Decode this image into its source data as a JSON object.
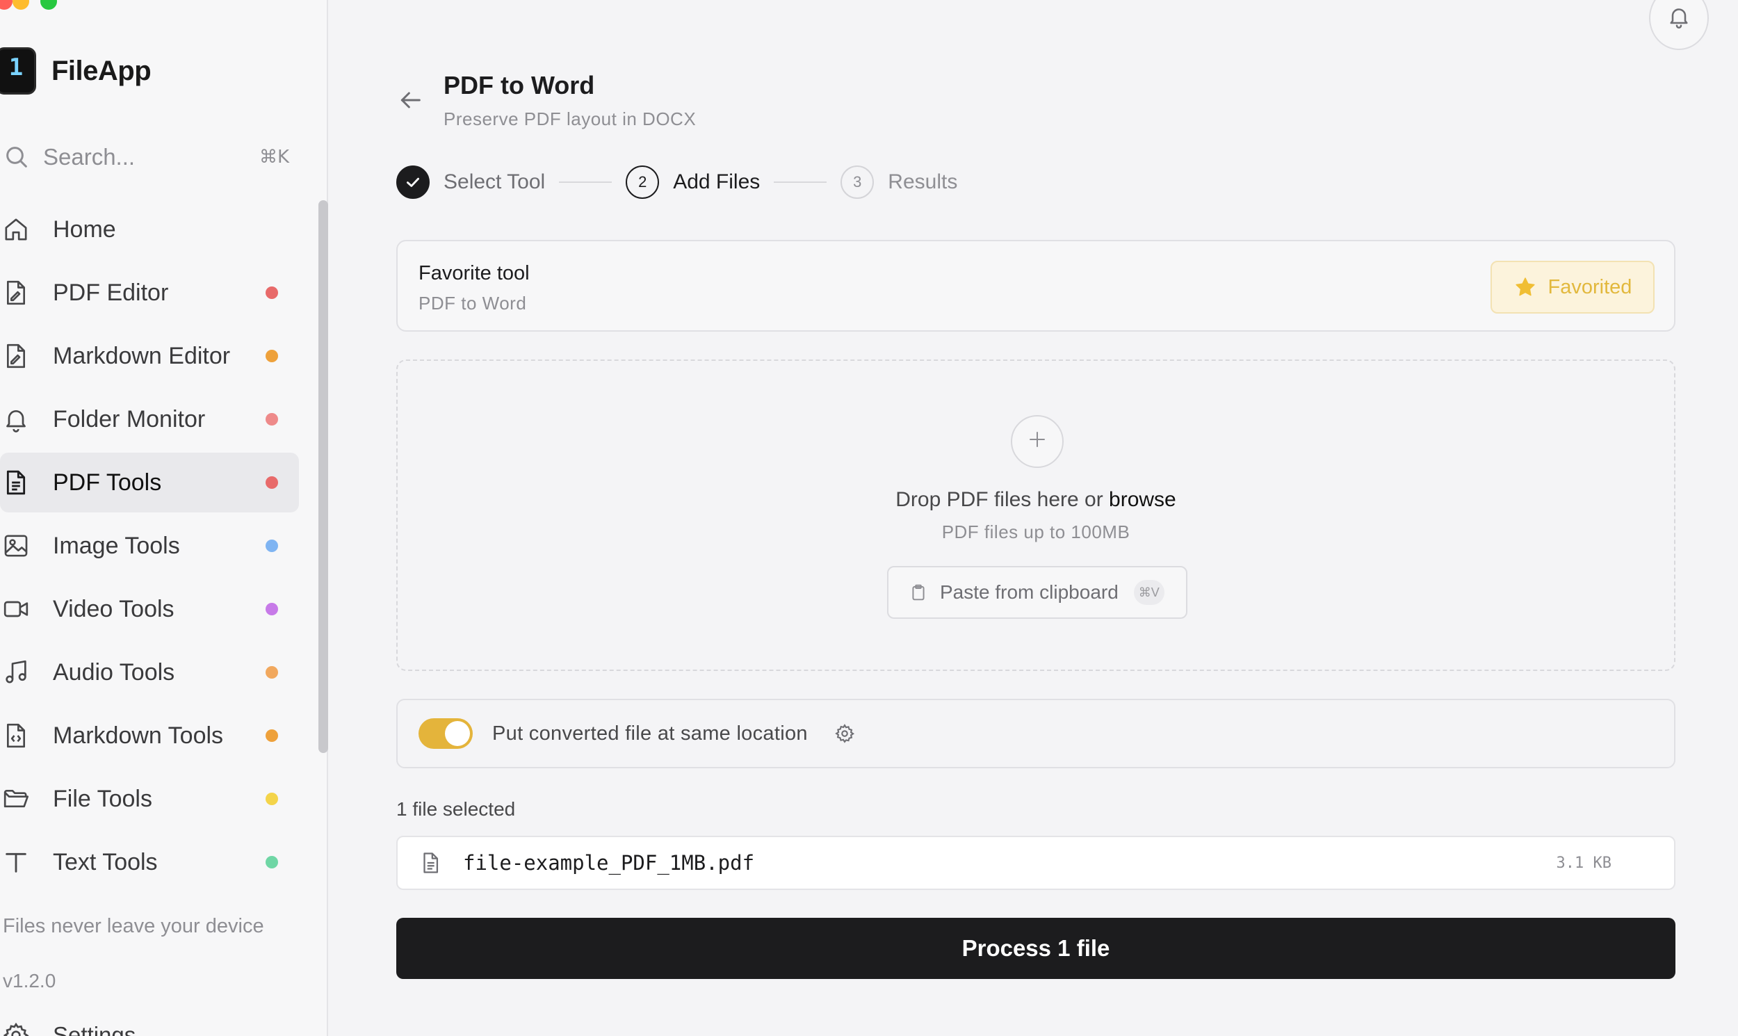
{
  "app": {
    "name": "FileApp",
    "logo_glyph": "1"
  },
  "search": {
    "placeholder": "Search...",
    "shortcut": "⌘K"
  },
  "sidebar": {
    "items": [
      {
        "label": "Home",
        "icon": "home-icon",
        "dot": null,
        "active": false
      },
      {
        "label": "PDF Editor",
        "icon": "pdf-editor-icon",
        "dot": "#e86a6a",
        "active": false
      },
      {
        "label": "Markdown Editor",
        "icon": "markdown-editor-icon",
        "dot": "#eea13b",
        "active": false
      },
      {
        "label": "Folder Monitor",
        "icon": "bell-icon",
        "dot": "#ee8a8a",
        "active": false
      },
      {
        "label": "PDF Tools",
        "icon": "document-icon",
        "dot": "#e86a6a",
        "active": true
      },
      {
        "label": "Image Tools",
        "icon": "image-icon",
        "dot": "#7fb4f2",
        "active": false
      },
      {
        "label": "Video Tools",
        "icon": "video-icon",
        "dot": "#c77ae8",
        "active": false
      },
      {
        "label": "Audio Tools",
        "icon": "music-icon",
        "dot": "#f1a85e",
        "active": false
      },
      {
        "label": "Markdown Tools",
        "icon": "code-file-icon",
        "dot": "#eea13b",
        "active": false
      },
      {
        "label": "File Tools",
        "icon": "folder-icon",
        "dot": "#f4d44a",
        "active": false
      },
      {
        "label": "Text Tools",
        "icon": "text-icon",
        "dot": "#6fd6a5",
        "active": false
      }
    ],
    "footer_note": "Files never leave your device",
    "version": "v1.2.0",
    "settings_label": "Settings"
  },
  "header": {
    "title": "PDF to Word",
    "subtitle": "Preserve PDF layout in DOCX"
  },
  "stepper": {
    "steps": [
      {
        "number": "1",
        "label": "Select Tool",
        "state": "done"
      },
      {
        "number": "2",
        "label": "Add Files",
        "state": "current"
      },
      {
        "number": "3",
        "label": "Results",
        "state": "todo"
      }
    ]
  },
  "favorite": {
    "title": "Favorite tool",
    "tool_name": "PDF to Word",
    "button_label": "Favorited"
  },
  "dropzone": {
    "text_prefix": "Drop PDF files here or ",
    "browse_label": "browse",
    "subtext": "PDF files up to 100MB",
    "paste_label": "Paste from clipboard",
    "paste_shortcut": "⌘V"
  },
  "option": {
    "toggle_on": true,
    "label": "Put converted file at same location"
  },
  "files": {
    "count_label": "1 file selected",
    "list": [
      {
        "name": "file-example_PDF_1MB.pdf",
        "size": "3.1 KB"
      }
    ]
  },
  "actions": {
    "process_label": "Process 1 file"
  },
  "colors": {
    "accent": "#1c1c1e",
    "toggle": "#e4b43b",
    "favorite": "#e2b83d"
  }
}
